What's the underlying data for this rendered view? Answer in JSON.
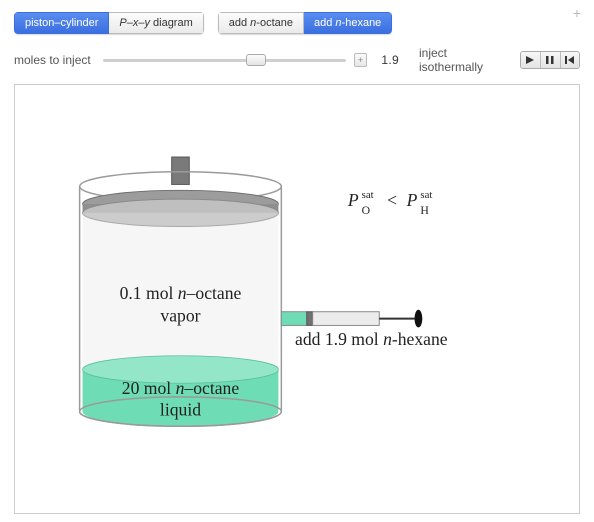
{
  "controls": {
    "view_group": {
      "piston": "piston–cylinder",
      "pxy": "P–x–y diagram",
      "active": "piston"
    },
    "add_group": {
      "octane": "add n-octane",
      "hexane": "add n-hexane",
      "active": "hexane"
    },
    "slider": {
      "label": "moles to inject",
      "value": "1.9",
      "min": 0,
      "max": 3,
      "pos_percent": 63
    },
    "anim": {
      "label": "inject isothermally"
    }
  },
  "diagram": {
    "relation_left_base": "P",
    "relation_left_sub": "O",
    "relation_sup": "sat",
    "relation_cmp": "<",
    "relation_right_base": "P",
    "relation_right_sub": "H",
    "vapor_line1_pre": "0.1 mol ",
    "vapor_line1_it": "n",
    "vapor_line1_post": "–octane",
    "vapor_line2": "vapor",
    "liquid_line1_pre": "20 mol ",
    "liquid_line1_it": "n",
    "liquid_line1_post": "–octane",
    "liquid_line2": "liquid",
    "syringe_pre": "add 1.9 mol ",
    "syringe_it": "n",
    "syringe_post": "-hexane"
  },
  "colors": {
    "liquid": "#6edcb4",
    "vapor": "#e8e8e8",
    "piston": "#7a7a7a",
    "cylinder_stroke": "#9a9a9a",
    "syringe_fill": "#e4e4e4",
    "accent": "#3b6fe0"
  }
}
